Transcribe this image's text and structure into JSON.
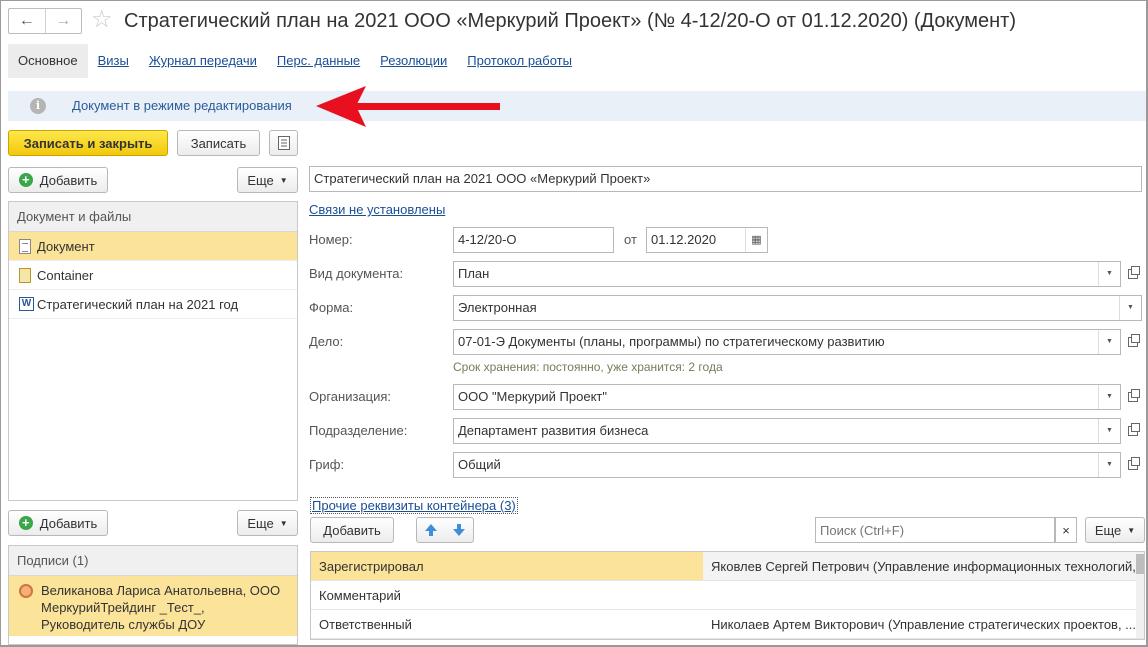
{
  "window": {
    "title": "Стратегический план на 2021 ООО «Меркурий Проект» (№ 4-12/20-О от 01.12.2020) (Документ)"
  },
  "tabs": [
    {
      "label": "Основное"
    },
    {
      "label": "Визы"
    },
    {
      "label": "Журнал передачи"
    },
    {
      "label": "Перс. данные"
    },
    {
      "label": "Резолюции"
    },
    {
      "label": "Протокол работы"
    }
  ],
  "infobar": {
    "text": "Документ в режиме редактирования"
  },
  "toolbar": {
    "save_close": "Записать и закрыть",
    "save": "Записать"
  },
  "files_panel": {
    "add": "Добавить",
    "more": "Еще",
    "header": "Документ и файлы",
    "items": [
      {
        "label": "Документ",
        "icon": "document-icon"
      },
      {
        "label": "Container",
        "icon": "container-icon"
      },
      {
        "label": "Стратегический план на 2021 год",
        "icon": "word-file-icon",
        "icon_glyph": "W"
      }
    ]
  },
  "signatures_panel": {
    "add": "Добавить",
    "more": "Еще",
    "header": "Подписи (1)",
    "item": "Великанова Лариса Анатольевна, ООО МеркурийТрейдинг _Тест_, Руководитель службы ДОУ"
  },
  "form": {
    "name": "Стратегический план на 2021 ООО «Меркурий Проект»",
    "links_label": "Связи не установлены",
    "number_label": "Номер:",
    "number": "4-12/20-О",
    "from_label": "от",
    "date": "01.12.2020",
    "doc_type_label": "Вид документа:",
    "doc_type": "План",
    "form_label": "Форма:",
    "form_value": "Электронная",
    "case_label": "Дело:",
    "case_value": "07-01-Э Документы (планы, программы) по стратегическому развитию",
    "storage_hint": "Срок хранения: постоянно, уже хранится: 2 года",
    "org_label": "Организация:",
    "org": "ООО \"Меркурий Проект\"",
    "dept_label": "Подразделение:",
    "dept": "Департамент развития бизнеса",
    "classification_label": "Гриф:",
    "classification": "Общий",
    "extra_link": "Прочие реквизиты контейнера (3)"
  },
  "props_toolbar": {
    "add": "Добавить",
    "search_placeholder": "Поиск (Ctrl+F)",
    "clear": "×",
    "more": "Еще"
  },
  "props_table": [
    {
      "name": "Зарегистрировал",
      "value": "Яковлев Сергей Петрович (Управление информационных технологий, ..."
    },
    {
      "name": "Комментарий",
      "value": ""
    },
    {
      "name": "Ответственный",
      "value": "Николаев Артем Викторович (Управление стратегических проектов, ..."
    }
  ],
  "colors": {
    "accent": "#f2c80c",
    "selection": "#fbe39a",
    "link": "#1a4f96",
    "arrow": "#e8101e"
  }
}
